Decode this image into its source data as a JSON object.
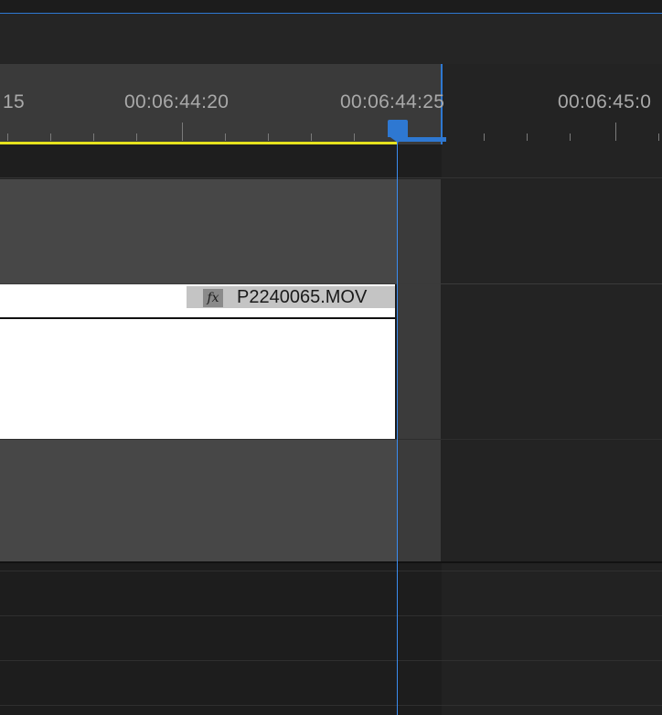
{
  "ruler": {
    "timecodes": [
      "15",
      "00:06:44:20",
      "00:06:44:25",
      "00:06:45:0"
    ]
  },
  "clip": {
    "fx_badge": "fx",
    "name": "P2240065.MOV"
  },
  "colors": {
    "playhead": "#2e78d2",
    "work_area_bar": "#e6e21e",
    "track_bg": "#474747",
    "clip_bg": "#ffffff"
  }
}
